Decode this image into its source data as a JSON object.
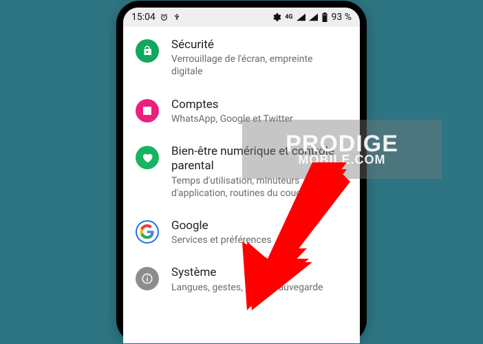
{
  "status": {
    "time": "15:04",
    "network_indicator": "4G",
    "battery_text": "93 %"
  },
  "icons": {
    "alarm": "alarm-icon",
    "usb": "usb-icon",
    "network_small": "4g-icon",
    "signal1": "signal-icon",
    "signal2": "signal-icon",
    "battery": "battery-icon"
  },
  "items": [
    {
      "id": "security",
      "title": "Sécurité",
      "subtitle": "Verrouillage de l'écran, empreinte digitale",
      "icon_color": "#10a85a"
    },
    {
      "id": "accounts",
      "title": "Comptes",
      "subtitle": "WhatsApp, Google et Twitter",
      "icon_color": "#ec1f7e"
    },
    {
      "id": "wellbeing",
      "title": "Bien-être numérique et contrôle parental",
      "subtitle": "Temps d'utilisation, minuteurs d'application, routines du coucher",
      "icon_color": "#17b45f"
    },
    {
      "id": "google",
      "title": "Google",
      "subtitle": "Services et préférences",
      "icon_color": "#ffffff"
    },
    {
      "id": "system",
      "title": "Système",
      "subtitle": "Langues, gestes, heure, sauvegarde",
      "icon_color": "#8d8d8d"
    }
  ],
  "watermark": {
    "line1": "PRODIGE",
    "line2": "MOBILE.COM"
  },
  "annotation": {
    "arrow_target": "system",
    "arrow_color": "#ff0000"
  }
}
